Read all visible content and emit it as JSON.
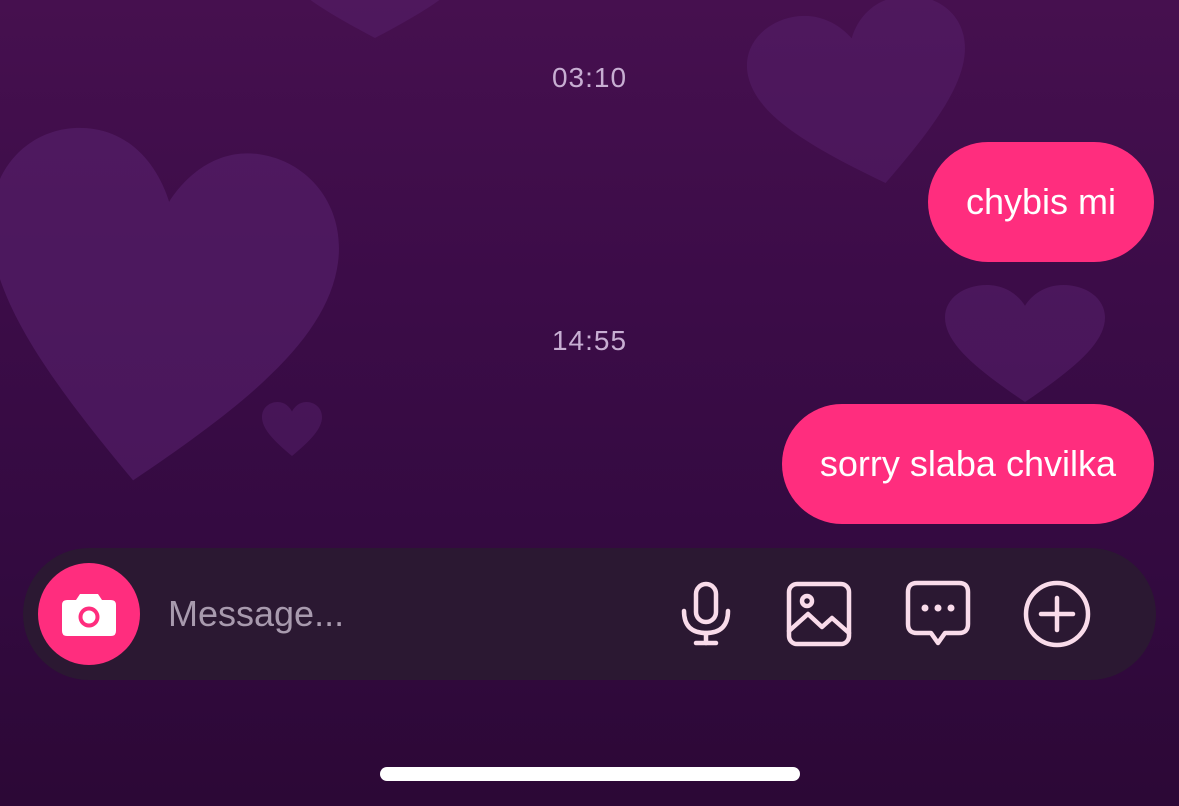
{
  "chat": {
    "background_color": "#3c0c48",
    "bubble_color": "#ff2d7e",
    "messages": [
      {
        "time": "03:10",
        "text": "chybis mi",
        "sender": "me"
      },
      {
        "time": "14:55",
        "text": "sorry slaba chvilka",
        "sender": "me"
      }
    ]
  },
  "composer": {
    "placeholder": "Message...",
    "camera_icon": "camera-icon",
    "tools": [
      "microphone-icon",
      "gallery-icon",
      "sticker-icon",
      "plus-icon"
    ]
  }
}
